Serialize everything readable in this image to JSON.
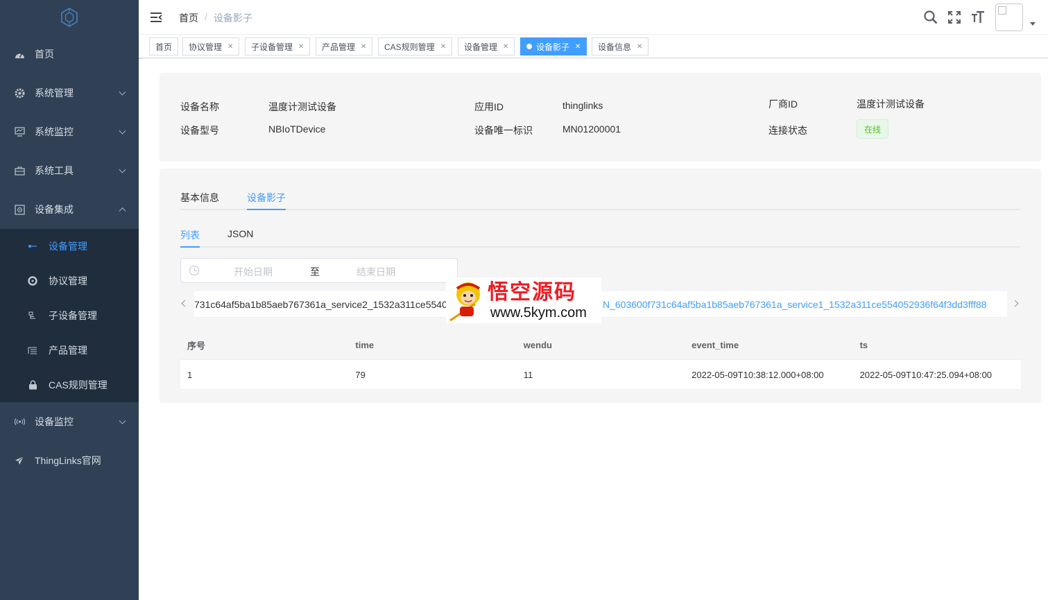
{
  "sidebar": {
    "items": [
      {
        "label": "首页",
        "icon": "dashboard-icon"
      },
      {
        "label": "系统管理",
        "icon": "gear-icon"
      },
      {
        "label": "系统监控",
        "icon": "monitor-icon"
      },
      {
        "label": "系统工具",
        "icon": "toolbox-icon"
      },
      {
        "label": "设备集成",
        "icon": "integration-icon"
      }
    ],
    "submenu": [
      {
        "label": "设备管理",
        "icon": "device-icon"
      },
      {
        "label": "协议管理",
        "icon": "protocol-icon"
      },
      {
        "label": "子设备管理",
        "icon": "sub-device-icon"
      },
      {
        "label": "产品管理",
        "icon": "product-list-icon"
      },
      {
        "label": "CAS规则管理",
        "icon": "lock-icon"
      }
    ],
    "bottom_items": [
      {
        "label": "设备监控",
        "icon": "broadcast-icon"
      },
      {
        "label": "ThingLinks官网",
        "icon": "paper-plane-icon"
      }
    ]
  },
  "navbar": {
    "breadcrumb": {
      "home": "首页",
      "separator": "/",
      "current": "设备影子"
    }
  },
  "tags": [
    "首页",
    "协议管理",
    "子设备管理",
    "产品管理",
    "CAS规则管理",
    "设备管理",
    "设备影子",
    "设备信息"
  ],
  "device": {
    "name_label": "设备名称",
    "name_value": "温度计测试设备",
    "app_label": "应用ID",
    "app_value": "thinglinks",
    "vendor_label": "厂商ID",
    "vendor_value": "温度计测试设备",
    "model_label": "设备型号",
    "model_value": "NBIoTDevice",
    "uid_label": "设备唯一标识",
    "uid_value": "MN01200001",
    "status_label": "连接状态",
    "status_value": "在线"
  },
  "tabs": {
    "basic": "基本信息",
    "shadow": "设备影子"
  },
  "subtabs": {
    "list": "列表",
    "json": "JSON"
  },
  "date_range": {
    "start_placeholder": "开始日期",
    "separator": "至",
    "end_placeholder": "结束日期"
  },
  "service_tabs": [
    "731c64af5ba1b85aeb767361a_service2_1532a311ce554052936f64f3dd3fff88",
    "N_603600f731c64af5ba1b85aeb767361a_service1_1532a311ce554052936f64f3dd3fff88"
  ],
  "table": {
    "columns": [
      "序号",
      "time",
      "wendu",
      "event_time",
      "ts"
    ],
    "rows": [
      [
        "1",
        "79",
        "11",
        "2022-05-09T10:38:12.000+08:00",
        "2022-05-09T10:47:25.094+08:00"
      ]
    ]
  },
  "watermark": {
    "title": "悟空源码",
    "url": "www.5kym.com"
  },
  "colors": {
    "sidebar": "#304156",
    "submenu": "#1f2d3d",
    "accent": "#409eff",
    "online": "#52c41a"
  }
}
